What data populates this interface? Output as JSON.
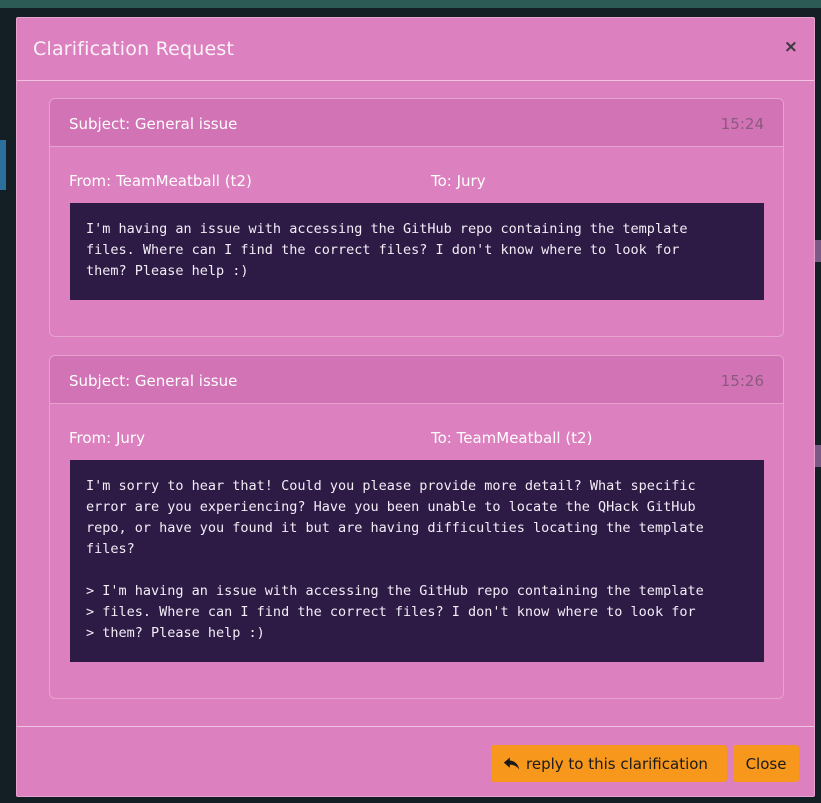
{
  "modal": {
    "title": "Clarification Request",
    "close_glyph": "×"
  },
  "messages": [
    {
      "subject": "Subject: General issue",
      "time": "15:24",
      "from": "From: TeamMeatball (t2)",
      "to": "To: Jury",
      "body": "I'm having an issue with accessing the GitHub repo containing the template\nfiles. Where can I find the correct files? I don't know where to look for\nthem? Please help :)"
    },
    {
      "subject": "Subject: General issue",
      "time": "15:26",
      "from": "From: Jury",
      "to": "To: TeamMeatball (t2)",
      "body": "I'm sorry to hear that! Could you please provide more detail? What specific\nerror are you experiencing? Have you been unable to locate the QHack GitHub\nrepo, or have you found it but are having difficulties locating the template\nfiles?\n\n> I'm having an issue with accessing the GitHub repo containing the template\n> files. Where can I find the correct files? I don't know where to look for\n> them? Please help :)"
    }
  ],
  "footer": {
    "reply_label": "reply to this clarification",
    "reply_icon": "reply-icon",
    "close_label": "Close"
  },
  "colors": {
    "modal_bg": "#dc80bf",
    "card_header_bg": "#d173b5",
    "message_bg": "#2d1b45",
    "button_bg": "#f7971c"
  }
}
